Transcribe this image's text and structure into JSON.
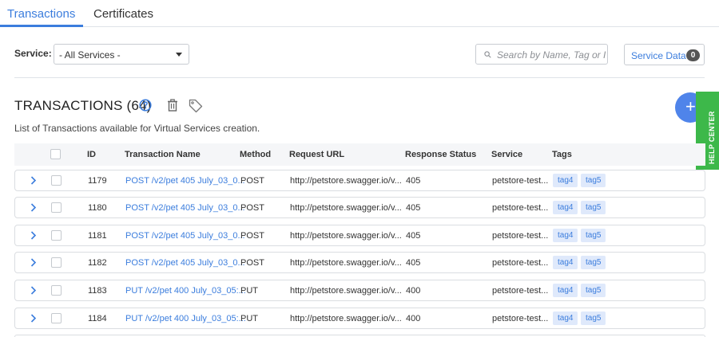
{
  "tabs": [
    {
      "label": "Transactions",
      "active": true
    },
    {
      "label": "Certificates",
      "active": false
    }
  ],
  "filter": {
    "service_label": "Service:",
    "service_value": "- All Services -",
    "search_placeholder": "Search by Name, Tag or ID",
    "service_data_label": "Service Data",
    "service_data_count": "0"
  },
  "header": {
    "title": "TRANSACTIONS (64)",
    "subtitle": "List of Transactions available for Virtual Services creation.",
    "help_center": "HELP CENTER",
    "add_symbol": "+"
  },
  "table": {
    "columns": [
      "ID",
      "Transaction Name",
      "Method",
      "Request URL",
      "Response Status",
      "Service",
      "Tags"
    ],
    "rows": [
      {
        "id": "1179",
        "name": "POST /v2/pet 405 July_03_0...",
        "method": "POST",
        "url": "http://petstore.swagger.io/v...",
        "status": "405",
        "service": "petstore-test...",
        "tags": [
          "tag4",
          "tag5"
        ]
      },
      {
        "id": "1180",
        "name": "POST /v2/pet 405 July_03_0...",
        "method": "POST",
        "url": "http://petstore.swagger.io/v...",
        "status": "405",
        "service": "petstore-test...",
        "tags": [
          "tag4",
          "tag5"
        ]
      },
      {
        "id": "1181",
        "name": "POST /v2/pet 405 July_03_0...",
        "method": "POST",
        "url": "http://petstore.swagger.io/v...",
        "status": "405",
        "service": "petstore-test...",
        "tags": [
          "tag4",
          "tag5"
        ]
      },
      {
        "id": "1182",
        "name": "POST /v2/pet 405 July_03_0...",
        "method": "POST",
        "url": "http://petstore.swagger.io/v...",
        "status": "405",
        "service": "petstore-test...",
        "tags": [
          "tag4",
          "tag5"
        ]
      },
      {
        "id": "1183",
        "name": "PUT /v2/pet 400 July_03_05:...",
        "method": "PUT",
        "url": "http://petstore.swagger.io/v...",
        "status": "400",
        "service": "petstore-test...",
        "tags": [
          "tag4",
          "tag5"
        ]
      },
      {
        "id": "1184",
        "name": "PUT /v2/pet 400 July_03_05:...",
        "method": "PUT",
        "url": "http://petstore.swagger.io/v...",
        "status": "400",
        "service": "petstore-test...",
        "tags": [
          "tag4",
          "tag5"
        ]
      }
    ]
  },
  "colors": {
    "accent": "#3b7ddd",
    "tag_bg": "#dfe9fb",
    "help_center_bg": "#3db84a",
    "fab_bg": "#4f84ea"
  },
  "icons": [
    "search-icon",
    "help-circle-icon",
    "trash-icon",
    "tag-icon",
    "chevron-right-icon",
    "plus-icon"
  ]
}
